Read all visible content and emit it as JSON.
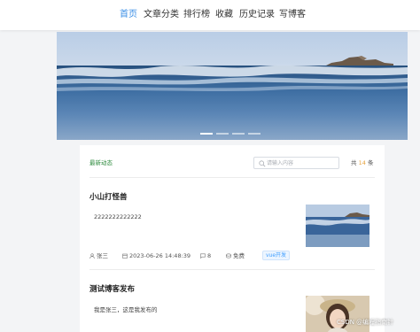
{
  "nav": {
    "items": [
      {
        "label": "首页",
        "active": true
      },
      {
        "label": "文章分类",
        "active": false
      },
      {
        "label": "排行榜",
        "active": false
      },
      {
        "label": "收藏",
        "active": false
      },
      {
        "label": "历史记录",
        "active": false
      },
      {
        "label": "写博客",
        "active": false
      }
    ]
  },
  "banner": {
    "slide_count": 4,
    "active_slide": 1
  },
  "feed": {
    "title": "最新动态",
    "search_placeholder": "请输入内容",
    "total_prefix": "共",
    "total_count": "14",
    "total_suffix": "条"
  },
  "posts": [
    {
      "title": "小山打怪兽",
      "body": "2222222222222",
      "author": "张三",
      "datetime": "2023-06-26 14:48:39",
      "comments": "8",
      "price": "免费",
      "tag": "vue开发"
    },
    {
      "title": "测试博客发布",
      "body": "我是张三，这是我发布的"
    }
  ],
  "watermark": "CSDN @编程指南针",
  "colors": {
    "accent": "#3a8ee6",
    "section_title": "#2e8b3e",
    "count": "#e6a23c",
    "tag_text": "#409eff"
  }
}
